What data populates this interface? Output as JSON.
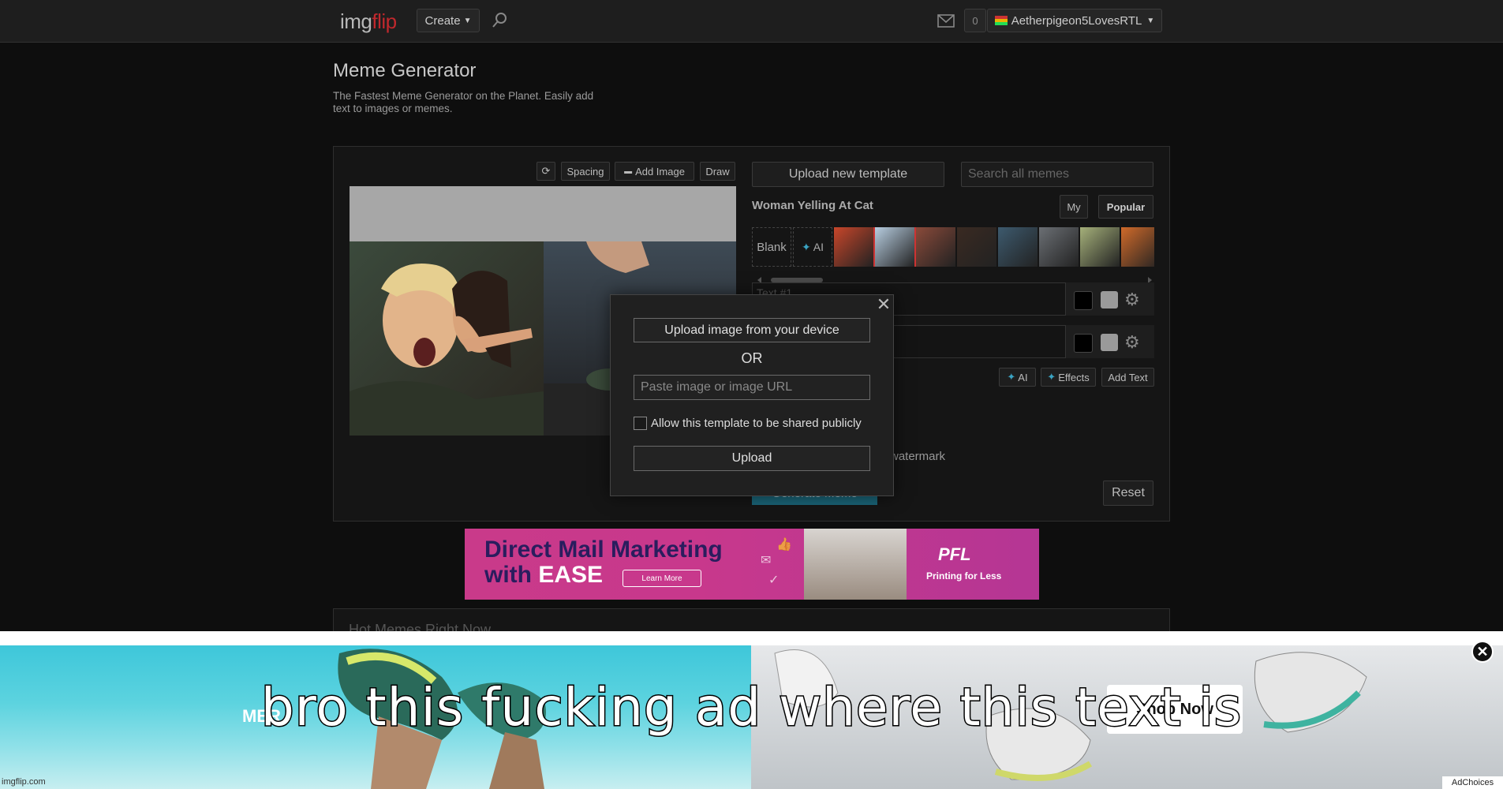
{
  "nav": {
    "logo_img": "img",
    "logo_flip": "flip",
    "create_label": "Create",
    "notif_count": "0",
    "username": "Aetherpigeon5LovesRTL"
  },
  "header": {
    "title": "Meme Generator",
    "subtitle": "The Fastest Meme Generator on the Planet. Easily add text to images or memes."
  },
  "editor": {
    "tools": {
      "spacing": "Spacing",
      "add_image": "Add Image",
      "draw": "Draw"
    },
    "upload_template": "Upload new template",
    "search_placeholder": "Search all memes",
    "template_name": "Woman Yelling At Cat",
    "tab_my": "My",
    "tab_popular": "Popular",
    "blank_tile": "Blank",
    "ai_tile": "AI",
    "text1_placeholder": "Text #1",
    "btn_ai": "AI",
    "btn_effects": "Effects",
    "btn_add_text": "Add Text",
    "watermark_label": "watermark",
    "generate_label": "Generate Meme",
    "reset_label": "Reset",
    "thumb_colors": [
      "#c8462a",
      "#b7cde0",
      "#8a4a3a",
      "#3a2a22",
      "#3d5a6e",
      "#6b6f74",
      "#a5b07a",
      "#d06a2a"
    ]
  },
  "modal": {
    "upload_device": "Upload image from your device",
    "or": "OR",
    "url_placeholder": "Paste image or image URL",
    "share_label": "Allow this template to be shared publicly",
    "upload": "Upload"
  },
  "ad_banner": {
    "headline1": "Direct Mail Marketing",
    "headline2a": "with ",
    "headline2b": "EASE",
    "learn_more": "Learn More",
    "brand": "PFL",
    "brand_sub": "Printing for Less"
  },
  "hot_memes_title": "Hot Memes Right Now",
  "bottom_ad": {
    "brand": "MER",
    "shop_now": "Shop Now",
    "caption": "bro this fucking ad where this text is",
    "adchoices": "AdChoices"
  },
  "footer_site": "imgflip.com"
}
